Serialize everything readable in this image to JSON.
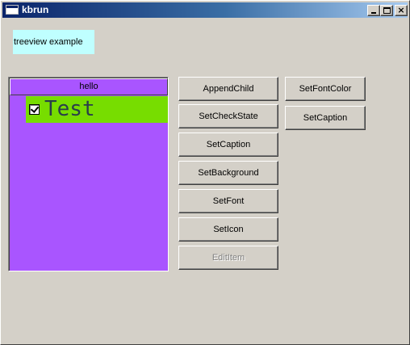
{
  "window": {
    "title": "kbrun",
    "controls": {
      "close_glyph": "×"
    }
  },
  "label": {
    "text": "treeview example",
    "background": "#bfffff"
  },
  "tree": {
    "header": "hello",
    "background": "#a955ff",
    "items": [
      {
        "text": "Test",
        "checked": true,
        "background": "#77dd00"
      }
    ]
  },
  "buttons": {
    "append_child": "AppendChild",
    "set_check_state": "SetCheckState",
    "set_caption": "SetCaption",
    "set_background": "SetBackground",
    "set_font": "SetFont",
    "set_icon": "SetIcon",
    "edit_item": "EditItem",
    "set_font_color": "SetFontColor",
    "set_caption_2": "SetCaption"
  },
  "colors": {
    "titlebar_start": "#0a246a",
    "titlebar_end": "#a6caf0",
    "face": "#d4d0c8"
  }
}
